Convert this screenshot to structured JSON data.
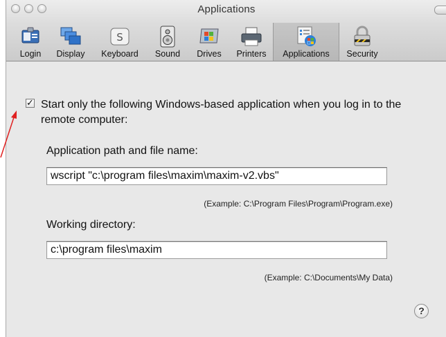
{
  "window": {
    "title": "Applications"
  },
  "toolbar": [
    {
      "id": "login",
      "label": "Login",
      "icon": "login-icon",
      "width": 52
    },
    {
      "id": "display",
      "label": "Display",
      "icon": "display-icon",
      "width": 64
    },
    {
      "id": "keyboard",
      "label": "Keyboard",
      "icon": "keyboard-icon",
      "width": 78
    },
    {
      "id": "sound",
      "label": "Sound",
      "icon": "speaker-icon",
      "width": 60
    },
    {
      "id": "drives",
      "label": "Drives",
      "icon": "drive-icon",
      "width": 60
    },
    {
      "id": "printers",
      "label": "Printers",
      "icon": "printer-icon",
      "width": 62
    },
    {
      "id": "applications",
      "label": "Applications",
      "icon": "applications-icon",
      "width": 96,
      "selected": true
    },
    {
      "id": "security",
      "label": "Security",
      "icon": "lock-icon",
      "width": 66
    }
  ],
  "panel": {
    "checkbox_checked": true,
    "checkbox_glyph": "✓",
    "checkbox_label": "Start only the following Windows-based application when you log in to the remote computer:",
    "app_path_label": "Application path and file name:",
    "app_path_value": "wscript \"c:\\program files\\maxim\\maxim-v2.vbs\"",
    "app_path_example": "(Example: C:\\Program Files\\Program\\Program.exe)",
    "workdir_label": "Working directory:",
    "workdir_value": "c:\\program files\\maxim",
    "workdir_example": "(Example: C:\\Documents\\My Data)",
    "help_glyph": "?"
  },
  "colors": {
    "annotation_arrow": "#e02020",
    "selected_tab": "#bcbcbc"
  }
}
